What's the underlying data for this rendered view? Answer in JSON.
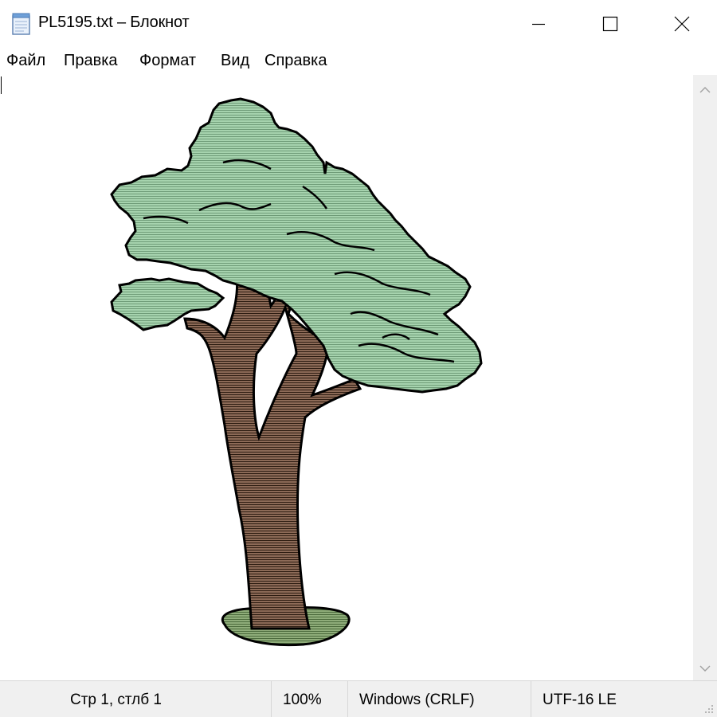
{
  "window": {
    "title": "PL5195.txt – Блокнот",
    "icon": "notepad-icon",
    "controls": [
      "minimize-icon",
      "maximize-icon",
      "close-icon"
    ]
  },
  "menu": {
    "items": [
      {
        "label": "Файл"
      },
      {
        "label": "Правка"
      },
      {
        "label": "Формат"
      },
      {
        "label": "Вид"
      },
      {
        "label": "Справка"
      }
    ]
  },
  "editor": {
    "content": "ASCII-art style picture of a tree"
  },
  "status": {
    "position": "Стр 1, стлб 1",
    "zoom": "100%",
    "line_endings": "Windows (CRLF)",
    "encoding": "UTF-16 LE"
  },
  "colors": {
    "foliage": "#a6d3ae",
    "trunk": "#8c6a57",
    "ground": "#8fad7a",
    "statusbar": "#f0f0f0",
    "scrollbar": "#f0f0f0"
  }
}
